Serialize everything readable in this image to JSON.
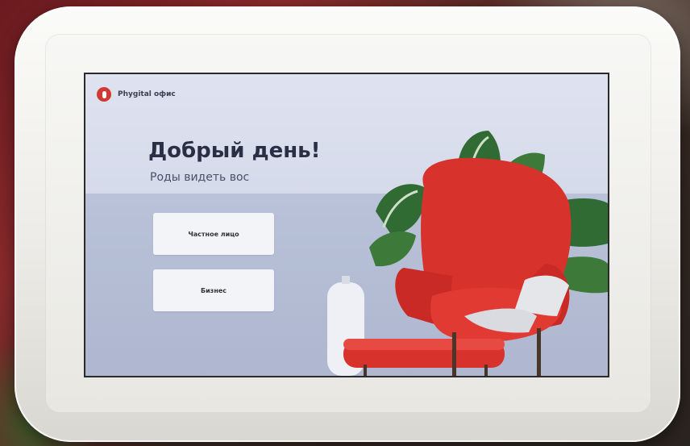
{
  "app": {
    "logo_text": "Phygital офис",
    "greeting": "Добрый день!",
    "subtitle": "Роды видеть вос"
  },
  "buttons": {
    "private_label": "Частное лицо",
    "business_label": "Бизнес"
  },
  "colors": {
    "accent": "#d13a34",
    "screen_bg": "#d7dcec",
    "text_dark": "#2a2f45"
  },
  "icons": {
    "logo": "phygital-logo-icon"
  }
}
